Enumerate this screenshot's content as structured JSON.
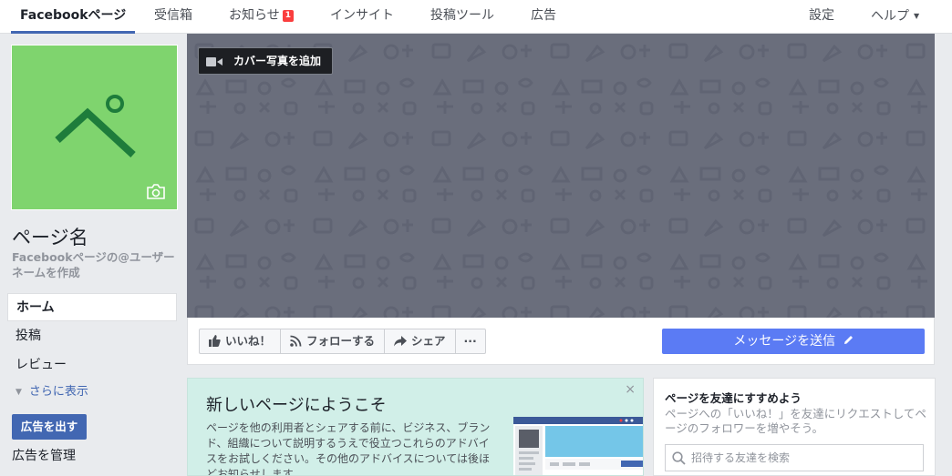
{
  "topnav": {
    "tabs": [
      {
        "label": "Facebookページ"
      },
      {
        "label": "受信箱"
      },
      {
        "label": "お知らせ",
        "badge": "1"
      },
      {
        "label": "インサイト"
      },
      {
        "label": "投稿ツール"
      },
      {
        "label": "広告"
      }
    ],
    "settings_label": "設定",
    "help_label": "ヘルプ"
  },
  "profile": {
    "page_name": "ページ名",
    "username_cta": "Facebookページの@ユーザーネームを作成",
    "avatar_color": "#7fd46e",
    "avatar_glyph_color": "#1e7c3b"
  },
  "leftnav": {
    "items": [
      {
        "label": "ホーム"
      },
      {
        "label": "投稿"
      },
      {
        "label": "レビュー"
      }
    ],
    "more_label": "さらに表示",
    "ad_button": "広告を出す",
    "ad_manage": "広告を管理"
  },
  "cover": {
    "add_cover_label": "カバー写真を追加",
    "bg_color": "#6a6e7c"
  },
  "actions": {
    "like_label": "いいね！",
    "follow_label": "フォローする",
    "share_label": "シェア",
    "more_label": "···",
    "message_label": "メッセージを送信",
    "message_color": "#5b7bf4"
  },
  "welcome": {
    "title": "新しいページにようこそ",
    "body": "ページを他の利用者とシェアする前に、ビジネス、ブランド、組織について説明するうえで役立つこれらのアドバイスをお試しください。その他のアドバイスについては後ほどお知らせします。",
    "close": "×"
  },
  "invite": {
    "title": "ページを友達にすすめよう",
    "desc": "ページへの「いいね！」を友達にリクエストしてページのフォロワーを増やそう。",
    "search_placeholder": "招待する友達を検索"
  }
}
